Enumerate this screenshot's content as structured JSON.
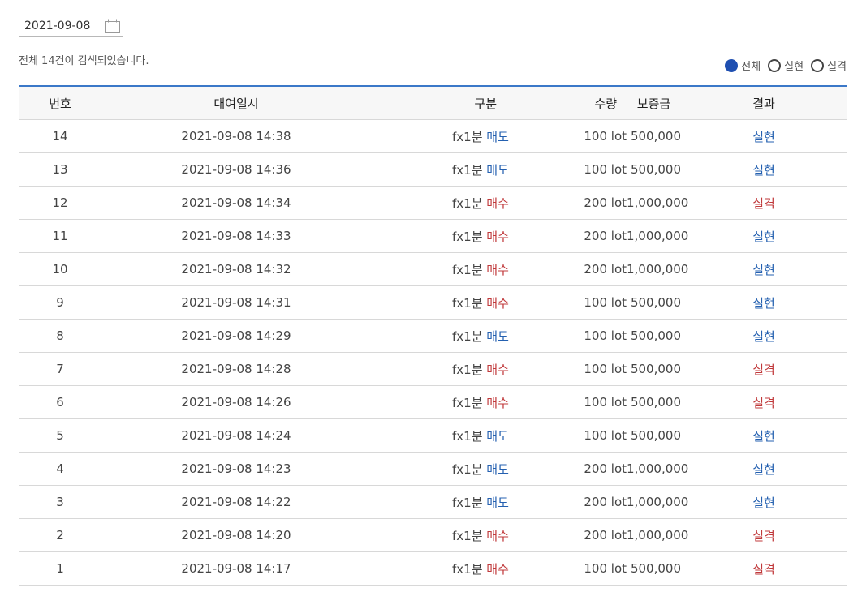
{
  "filter_date": "2021-09-08",
  "summary_text": "전체 14건이 검색되었습니다.",
  "radio_options": [
    {
      "label": "전체",
      "checked": true
    },
    {
      "label": "실현",
      "checked": false
    },
    {
      "label": "실격",
      "checked": false
    }
  ],
  "table": {
    "headers": [
      "번호",
      "대여일시",
      "구분",
      "수량",
      "보증금",
      "결과"
    ],
    "rows": [
      {
        "no": "14",
        "datetime": "2021-09-08 14:38",
        "product": "fx1분",
        "side": "매도",
        "qty": "100 lot",
        "deposit": "500,000",
        "result": "실현"
      },
      {
        "no": "13",
        "datetime": "2021-09-08 14:36",
        "product": "fx1분",
        "side": "매도",
        "qty": "100 lot",
        "deposit": "500,000",
        "result": "실현"
      },
      {
        "no": "12",
        "datetime": "2021-09-08 14:34",
        "product": "fx1분",
        "side": "매수",
        "qty": "200 lot",
        "deposit": "1,000,000",
        "result": "실격"
      },
      {
        "no": "11",
        "datetime": "2021-09-08 14:33",
        "product": "fx1분",
        "side": "매수",
        "qty": "200 lot",
        "deposit": "1,000,000",
        "result": "실현"
      },
      {
        "no": "10",
        "datetime": "2021-09-08 14:32",
        "product": "fx1분",
        "side": "매수",
        "qty": "200 lot",
        "deposit": "1,000,000",
        "result": "실현"
      },
      {
        "no": "9",
        "datetime": "2021-09-08 14:31",
        "product": "fx1분",
        "side": "매수",
        "qty": "100 lot",
        "deposit": "500,000",
        "result": "실현"
      },
      {
        "no": "8",
        "datetime": "2021-09-08 14:29",
        "product": "fx1분",
        "side": "매도",
        "qty": "100 lot",
        "deposit": "500,000",
        "result": "실현"
      },
      {
        "no": "7",
        "datetime": "2021-09-08 14:28",
        "product": "fx1분",
        "side": "매수",
        "qty": "100 lot",
        "deposit": "500,000",
        "result": "실격"
      },
      {
        "no": "6",
        "datetime": "2021-09-08 14:26",
        "product": "fx1분",
        "side": "매수",
        "qty": "100 lot",
        "deposit": "500,000",
        "result": "실격"
      },
      {
        "no": "5",
        "datetime": "2021-09-08 14:24",
        "product": "fx1분",
        "side": "매도",
        "qty": "100 lot",
        "deposit": "500,000",
        "result": "실현"
      },
      {
        "no": "4",
        "datetime": "2021-09-08 14:23",
        "product": "fx1분",
        "side": "매도",
        "qty": "200 lot",
        "deposit": "1,000,000",
        "result": "실현"
      },
      {
        "no": "3",
        "datetime": "2021-09-08 14:22",
        "product": "fx1분",
        "side": "매도",
        "qty": "200 lot",
        "deposit": "1,000,000",
        "result": "실현"
      },
      {
        "no": "2",
        "datetime": "2021-09-08 14:20",
        "product": "fx1분",
        "side": "매수",
        "qty": "200 lot",
        "deposit": "1,000,000",
        "result": "실격"
      },
      {
        "no": "1",
        "datetime": "2021-09-08 14:17",
        "product": "fx1분",
        "side": "매수",
        "qty": "100 lot",
        "deposit": "500,000",
        "result": "실격"
      }
    ]
  },
  "colors": {
    "accent_blue": "#2460b0",
    "accent_red": "#c0393b",
    "radio_checked": "#1f4fb1",
    "header_top_border": "#3b78c8"
  },
  "icons": {
    "date_picker": "calendar-icon"
  }
}
